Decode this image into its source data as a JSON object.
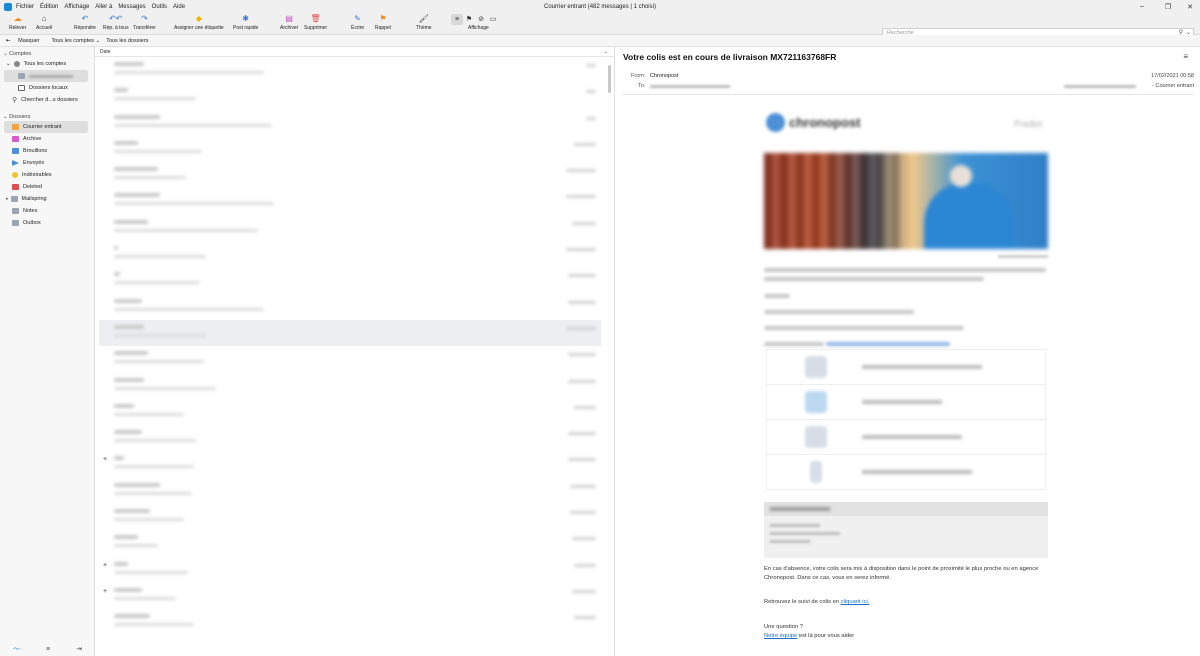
{
  "window": {
    "title": "Courrier entrant (482 messages | 1 choisi)",
    "controls": [
      "–",
      "❐",
      "✕"
    ]
  },
  "menu": [
    "Fichier",
    "Édition",
    "Affichage",
    "Aller à",
    "Messages",
    "Outils",
    "Aide"
  ],
  "toolbar": {
    "relever": "Relever",
    "accueil": "Accueil",
    "repondre": "Répondre",
    "rep_tous": "Rép. à tous",
    "transferer": "Transférer",
    "etiquette": "Assigner une étiquette",
    "post_rapide": "Post rapide",
    "archiver": "Archiver",
    "supprimer": "Supprimer",
    "ecrire": "Écrire",
    "rappel": "Rappel",
    "theme": "Thème",
    "affichage": "Affichage"
  },
  "search": {
    "placeholder": "Recherche"
  },
  "filterbar": {
    "masquer": "Masquer",
    "tous_comptes": "Tous les comptes",
    "tous_dossiers": "Tous les dossiers"
  },
  "sidebar": {
    "comptes_label": "Comptes",
    "tous_comptes": "Tous les comptes",
    "dossiers_locaux": "Dossiers locaux",
    "chercher": "Chercher d...s dossiers",
    "dossiers_label": "Dossiers",
    "folders": [
      "Courrier entrant",
      "Archive",
      "Brouillons",
      "Envoyés",
      "Indésirables",
      "Deleted",
      "Mailspring",
      "Notes",
      "Outbox"
    ],
    "colors": {
      "inbox": "#f0a640",
      "archive": "#d65bd0",
      "drafts": "#4a8fd8",
      "sent": "#4a8fd8",
      "junk": "#f2c12e",
      "deleted": "#e05050",
      "folder": "#9aa4b2"
    }
  },
  "list": {
    "column_date": "Date"
  },
  "reader": {
    "subject": "Votre colis  est en cours de livraison MX721163768FR",
    "from_label": "From:",
    "from": "Chronopost",
    "to_label": "To:",
    "date": "17/02/2021 00:58",
    "folder": "- Courrier entrant",
    "absence_text": "En cas d'absence, votre colis sera mis à disposition dans le point de proximité le plus proche ou en agence Chronopost. Dans ce cas, vous en serez informé.",
    "suivi_pre": "Retrouvez le suivi de colis en ",
    "suivi_link": "cliquant ici.",
    "question": "Une question ?",
    "equipe_link": "Notre équipe",
    "equipe_post": " est là pour vous aider"
  },
  "accent": "#1b8ad6"
}
